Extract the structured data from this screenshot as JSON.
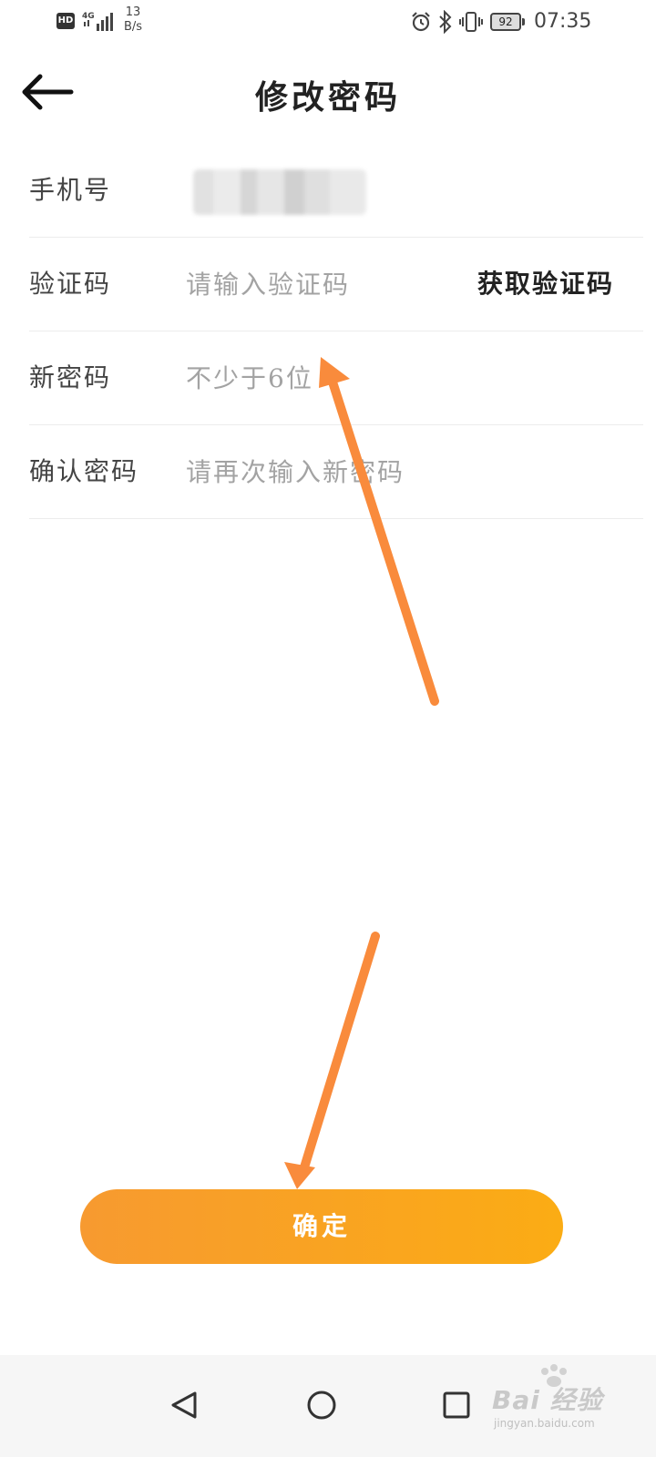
{
  "status_bar": {
    "hd": "HD",
    "network": "4G",
    "speed_value": "13",
    "speed_unit": "B/s",
    "battery": "92",
    "time": "07:35"
  },
  "header": {
    "title": "修改密码"
  },
  "form": {
    "rows": [
      {
        "label": "手机号"
      },
      {
        "label": "验证码",
        "placeholder": "请输入验证码",
        "action": "获取验证码"
      },
      {
        "label": "新密码",
        "placeholder": "不少于6位"
      },
      {
        "label": "确认密码",
        "placeholder": "请再次输入新密码"
      }
    ]
  },
  "confirm": {
    "label": "确定"
  },
  "watermark": {
    "main": "Bai 经验",
    "sub": "jingyan.baidu.com"
  },
  "colors": {
    "accent_start": "#f79a30",
    "accent_end": "#fbac14",
    "annotation_arrow": "#f98b3c"
  }
}
